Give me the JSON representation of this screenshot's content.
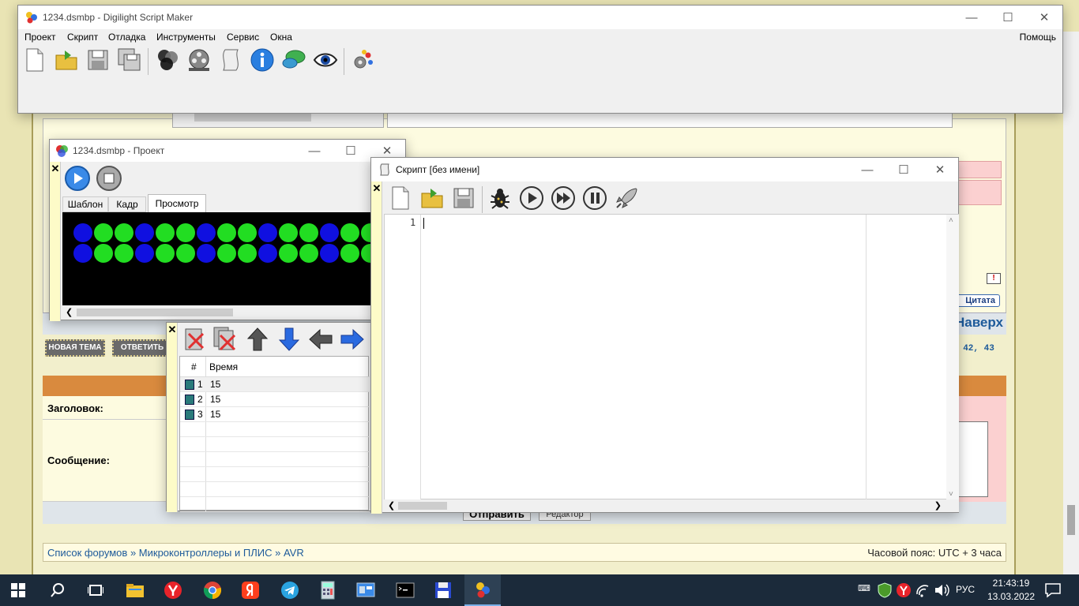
{
  "main_window": {
    "title": "1234.dsmbp - Digilight Script Maker",
    "menu": [
      "Проект",
      "Скрипт",
      "Отладка",
      "Инструменты",
      "Сервис",
      "Окна"
    ],
    "help": "Помощь",
    "toolbar_icons": [
      "new-file-icon",
      "open-folder-icon",
      "save-icon",
      "save-all-icon",
      "color-mix-icon",
      "film-reel-icon",
      "script-scroll-icon",
      "info-icon",
      "chat-icon",
      "eye-icon",
      "settings-gears-icon"
    ]
  },
  "project_window": {
    "title": "1234.dsmbp - Проект",
    "tabs": [
      "Шаблон",
      "Кадр",
      "Просмотр"
    ],
    "active_tab": "Просмотр",
    "colors": {
      "blue": "#1010e0",
      "green": "#22dd22",
      "bg": "#000000"
    },
    "row_pattern": [
      "blue",
      "green",
      "green",
      "blue",
      "green",
      "green",
      "blue",
      "green",
      "green",
      "blue",
      "green",
      "green",
      "blue",
      "green",
      "green"
    ]
  },
  "frames_panel": {
    "columns": [
      "#",
      "Время"
    ],
    "rows": [
      {
        "num": "1",
        "time": "15"
      },
      {
        "num": "2",
        "time": "15"
      },
      {
        "num": "3",
        "time": "15"
      }
    ]
  },
  "script_window": {
    "title": "Скрипт [без имени]",
    "line_number": "1"
  },
  "forum_bg": {
    "new_topic": "НОВАЯ ТЕМА",
    "reply": "ОТВЕТИТЬ",
    "subject_label": "Заголовок:",
    "message_label": "Сообщение:",
    "send": "Отправить",
    "editor": "Редактор",
    "quote": "Цитата",
    "top": "Наверх",
    "pages": ", 42, 43",
    "breadcrumb": [
      "Список форумов",
      "Микроконтроллеры и ПЛИС",
      "AVR"
    ],
    "breadcrumb_sep": "»",
    "timezone": "Часовой пояс: UTC + 3 часа"
  },
  "taskbar": {
    "time": "21:43:19",
    "date": "13.03.2022",
    "lang": "РУС",
    "apps": [
      "search-icon",
      "task-view-icon",
      "file-explorer-icon",
      "yandex-browser-icon",
      "chrome-icon",
      "yandex-icon",
      "telegram-icon",
      "calculator-icon",
      "control-panel-icon",
      "terminal-icon",
      "floppy-app-icon",
      "digilight-app-icon"
    ]
  }
}
